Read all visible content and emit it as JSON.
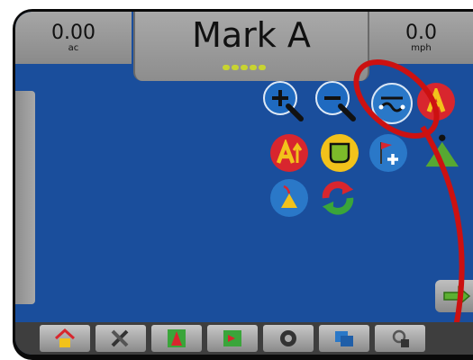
{
  "left_stat": {
    "value": "0.00",
    "unit": "ac"
  },
  "title": {
    "name": "Mark A"
  },
  "right_stat": {
    "value": "0.0",
    "unit": "mph"
  },
  "colors": {
    "map_background": "#1a4e9c",
    "panel_gray": "#9a9a9a",
    "highlight_red": "#cc1111"
  },
  "map_tools": [
    {
      "name": "zoom-in-icon"
    },
    {
      "name": "zoom-out-icon"
    },
    {
      "name": "guidance-mode-icon"
    },
    {
      "name": "mark-a-point-icon"
    },
    {
      "name": "a-plus-nudge-icon"
    },
    {
      "name": "boundary-icon"
    },
    {
      "name": "add-marker-point-icon"
    },
    {
      "name": "marker-green-icon"
    },
    {
      "name": "last-pass-icon"
    },
    {
      "name": "refresh-view-icon"
    }
  ],
  "taskbar": [
    {
      "name": "home-icon"
    },
    {
      "name": "tools-icon"
    },
    {
      "name": "guidance-icon"
    },
    {
      "name": "mapping-icon"
    },
    {
      "name": "gnss-icon"
    },
    {
      "name": "system-icon"
    },
    {
      "name": "lock-icon"
    }
  ]
}
